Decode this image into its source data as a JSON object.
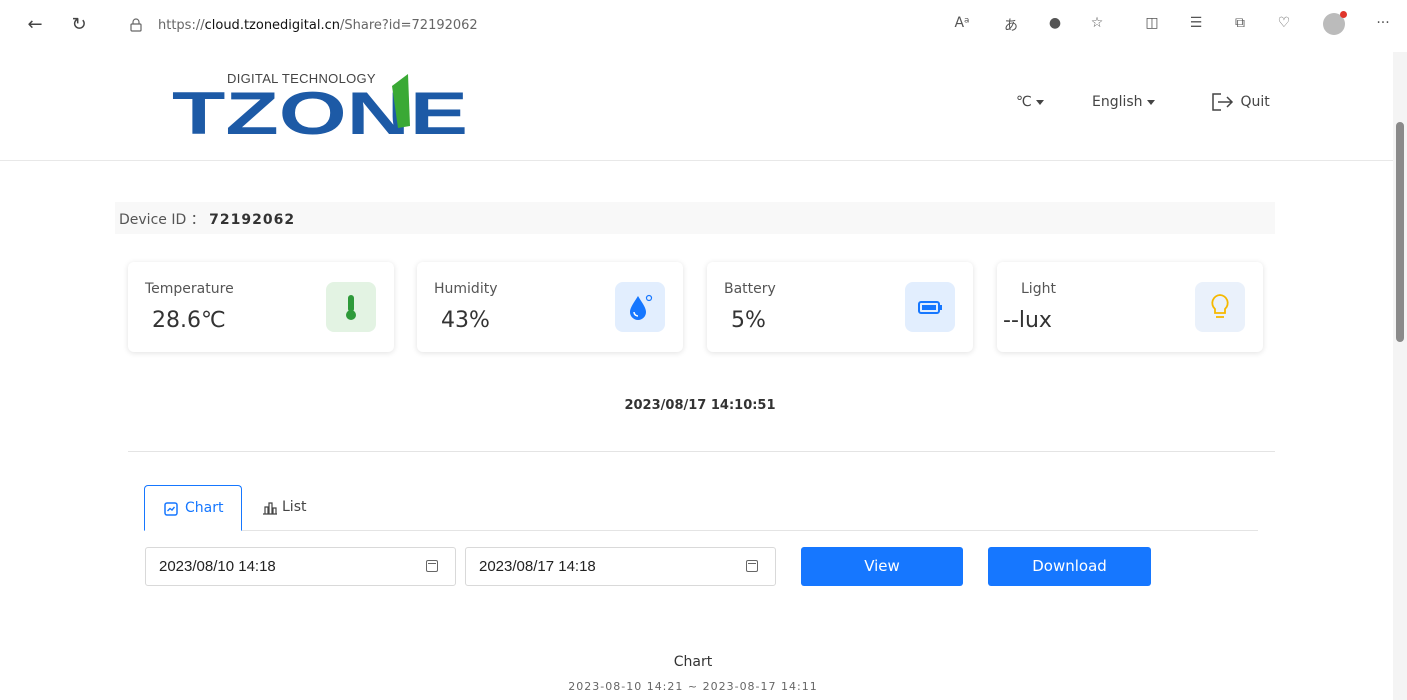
{
  "browser": {
    "url_prefix": "https://",
    "url_domain": "cloud.tzonedigital.cn",
    "url_path": "/Share?id=72192062",
    "read_aloud_icon": "Aᵃ",
    "translate_icon": "あ",
    "more_label": "···"
  },
  "header": {
    "logo_subtitle": "DIGITAL TECHNOLOGY",
    "logo_text": "TZONE",
    "unit_label": "℃",
    "language_label": "English",
    "quit_label": "Quit"
  },
  "device": {
    "label": "Device ID ：",
    "id": "72192062"
  },
  "cards": [
    {
      "label": "Temperature",
      "value": "28.6℃",
      "icon": "thermometer-icon",
      "color": "#2e9a3a",
      "bg": "#e3f3e3"
    },
    {
      "label": "Humidity",
      "value": "43%",
      "icon": "water-drop-icon",
      "color": "#1677ff",
      "bg": "#e2eefe"
    },
    {
      "label": "Battery",
      "value": "5%",
      "icon": "battery-icon",
      "color": "#1677ff",
      "bg": "#e2eefe"
    },
    {
      "label": "Light",
      "value": "--lux",
      "icon": "light-bulb-icon",
      "color": "#f5b800",
      "bg": "#eaf1fb"
    }
  ],
  "timestamp": "2023/08/17 14:10:51",
  "tabs": [
    {
      "label": "Chart",
      "active": true
    },
    {
      "label": "List",
      "active": false
    }
  ],
  "filters": {
    "start_date": "2023/08/10 14:18",
    "end_date": "2023/08/17 14:18",
    "view_label": "View",
    "download_label": "Download"
  },
  "chart": {
    "title": "Chart",
    "range": "2023-08-10 14:21 ~ 2023-08-17 14:11"
  },
  "colors": {
    "primary": "#1677ff",
    "logo_blue": "#1d5aa6",
    "logo_green": "#3aa935"
  }
}
